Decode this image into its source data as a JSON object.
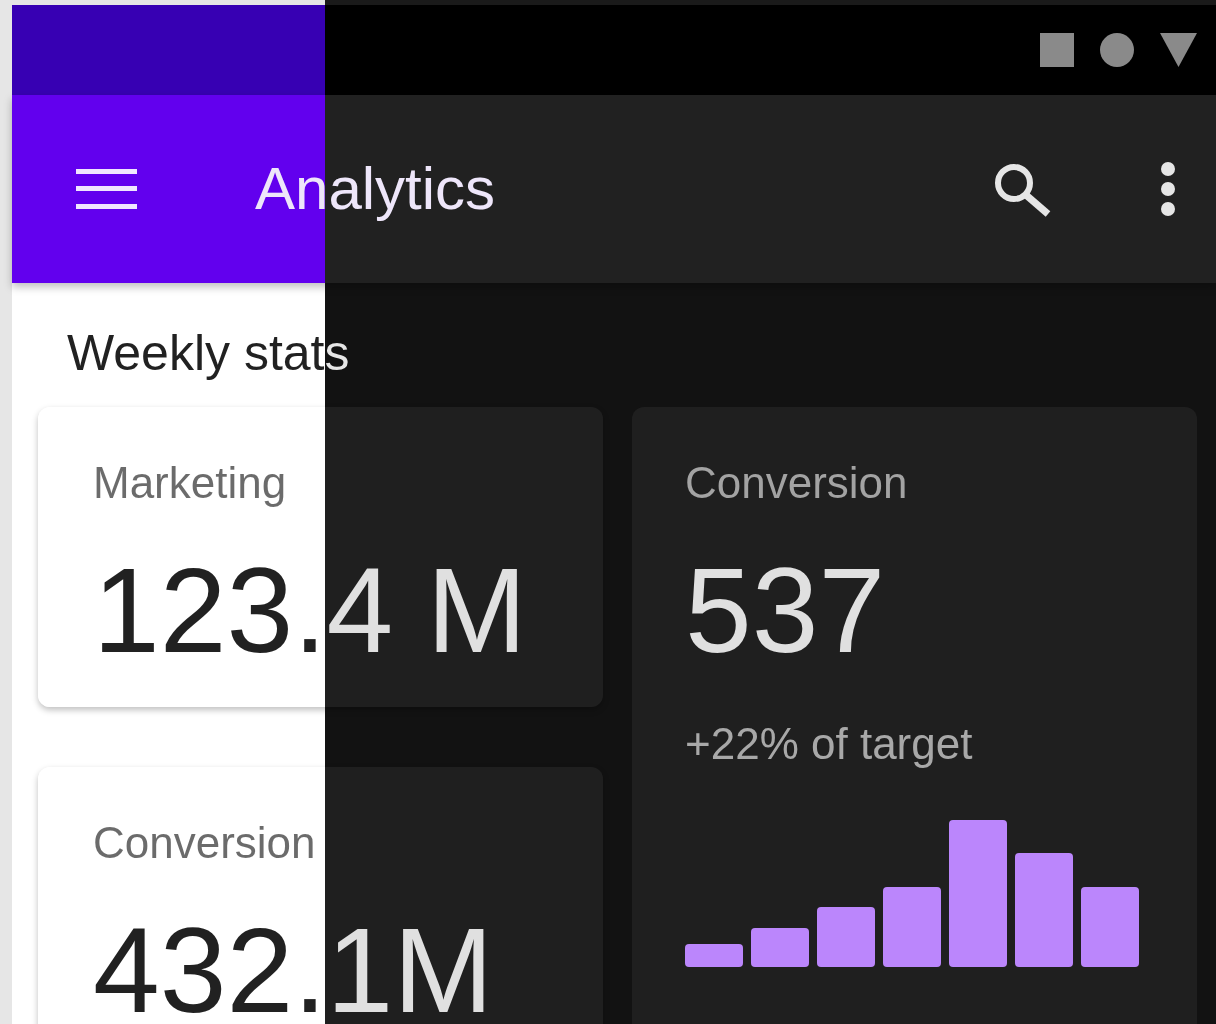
{
  "app_bar": {
    "title": "Analytics"
  },
  "section_title": "Weekly stats",
  "cards": [
    {
      "kind": "stat",
      "label": "Marketing",
      "value": "123.4 M"
    },
    {
      "kind": "stat",
      "label": "Conversion",
      "value": "432.1M"
    },
    {
      "kind": "chart",
      "label": "Conversion",
      "value": "537",
      "note": "+22% of target"
    }
  ]
}
